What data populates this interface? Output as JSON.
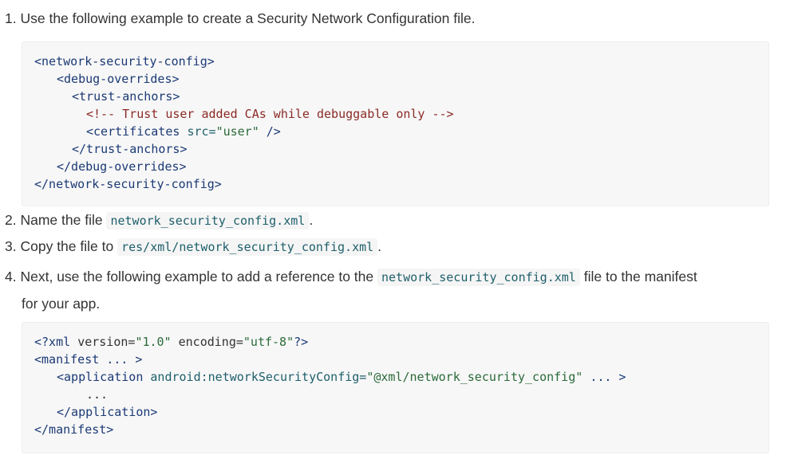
{
  "steps": [
    {
      "num": "1.",
      "text": "Use the following example to create a Security Network Configuration file."
    },
    {
      "num": "2.",
      "before": "Name the file",
      "code": "network_security_config.xml",
      "after": "."
    },
    {
      "num": "3.",
      "before": "Copy the file to",
      "code": "res/xml/network_security_config.xml",
      "after": "."
    },
    {
      "num": "4.",
      "before": "Next, use the following example to add a reference to the",
      "code": "network_security_config.xml",
      "after": "file to the manifest",
      "cont": "for your app."
    }
  ],
  "code_block_1": {
    "l1": "<network-security-config>",
    "l2": "<debug-overrides>",
    "l3": "<trust-anchors>",
    "l4": "<!-- Trust user added CAs while debuggable only -->",
    "l5_open": "<certificates",
    "l5_attr": "src=",
    "l5_val": "\"user\"",
    "l5_close": "/>",
    "l6": "</trust-anchors>",
    "l7": "</debug-overrides>",
    "l8": "</network-security-config>"
  },
  "code_block_2": {
    "l1_open": "<?xml",
    "l1_attr1": "version=",
    "l1_val1": "\"1.0\"",
    "l1_attr2": "encoding=",
    "l1_val2": "\"utf-8\"",
    "l1_close": "?>",
    "l2_open": "<manifest",
    "l2_rest": "... >",
    "l3_open": "<application",
    "l3_attr": "android:networkSecurityConfig=",
    "l3_val": "\"@xml/network_security_config\"",
    "l3_rest": "... >",
    "l4": "...",
    "l5": "</application>",
    "l6": "</manifest>"
  }
}
